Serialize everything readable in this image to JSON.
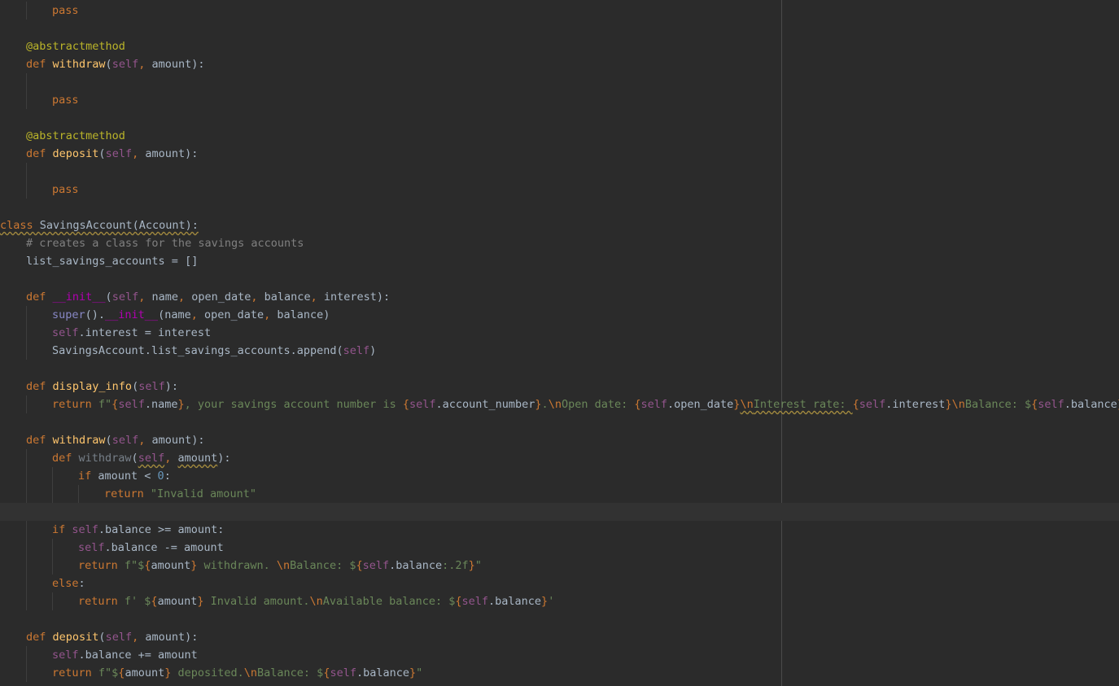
{
  "editor": {
    "theme": {
      "background": "#2b2b2b",
      "foreground": "#a9b7c6",
      "current_line": "#323232",
      "margin_line": "#4a4a4a"
    },
    "lines": [
      {
        "indent": 2,
        "tokens": [
          [
            "pass",
            "kw"
          ]
        ]
      },
      {
        "indent": 0,
        "tokens": []
      },
      {
        "indent": 1,
        "tokens": [
          [
            "@abstractmethod",
            "deco"
          ]
        ]
      },
      {
        "indent": 1,
        "tokens": [
          [
            "def ",
            "kw"
          ],
          [
            "withdraw",
            "fn"
          ],
          [
            "(",
            ""
          ],
          [
            "self",
            "self"
          ],
          [
            ", ",
            "kw"
          ],
          [
            "amount):",
            ""
          ]
        ]
      },
      {
        "indent": 2,
        "tokens": []
      },
      {
        "indent": 2,
        "tokens": [
          [
            "pass",
            "kw"
          ]
        ]
      },
      {
        "indent": 0,
        "tokens": []
      },
      {
        "indent": 1,
        "tokens": [
          [
            "@abstractmethod",
            "deco"
          ]
        ]
      },
      {
        "indent": 1,
        "tokens": [
          [
            "def ",
            "kw"
          ],
          [
            "deposit",
            "fn"
          ],
          [
            "(",
            ""
          ],
          [
            "self",
            "self"
          ],
          [
            ", ",
            "kw"
          ],
          [
            "amount):",
            ""
          ]
        ]
      },
      {
        "indent": 2,
        "tokens": []
      },
      {
        "indent": 2,
        "tokens": [
          [
            "pass",
            "kw"
          ]
        ]
      },
      {
        "indent": 0,
        "tokens": []
      },
      {
        "indent": 0,
        "tokens": [
          [
            "class ",
            "kw wavy"
          ],
          [
            "SavingsAccount(Account):",
            "wavy"
          ]
        ]
      },
      {
        "indent": 1,
        "tokens": [
          [
            "# creates a class for the savings accounts",
            "cmt"
          ]
        ]
      },
      {
        "indent": 1,
        "tokens": [
          [
            "list_savings_accounts = []",
            ""
          ]
        ]
      },
      {
        "indent": 0,
        "tokens": []
      },
      {
        "indent": 1,
        "tokens": [
          [
            "def ",
            "kw"
          ],
          [
            "__init__",
            "dunder"
          ],
          [
            "(",
            ""
          ],
          [
            "self",
            "self"
          ],
          [
            ", ",
            "kw"
          ],
          [
            "name",
            ""
          ],
          [
            ", ",
            "kw"
          ],
          [
            "open_date",
            ""
          ],
          [
            ", ",
            "kw"
          ],
          [
            "balance",
            ""
          ],
          [
            ", ",
            "kw"
          ],
          [
            "interest):",
            ""
          ]
        ]
      },
      {
        "indent": 2,
        "tokens": [
          [
            "super",
            "bi"
          ],
          [
            "().",
            ""
          ],
          [
            "__init__",
            "dunder"
          ],
          [
            "(name",
            ""
          ],
          [
            ", ",
            "kw"
          ],
          [
            "open_date",
            ""
          ],
          [
            ", ",
            "kw"
          ],
          [
            "balance)",
            ""
          ]
        ]
      },
      {
        "indent": 2,
        "tokens": [
          [
            "self",
            "self"
          ],
          [
            ".interest = interest",
            ""
          ]
        ]
      },
      {
        "indent": 2,
        "tokens": [
          [
            "SavingsAccount.list_savings_accounts.append(",
            ""
          ],
          [
            "self",
            "self"
          ],
          [
            ")",
            ""
          ]
        ]
      },
      {
        "indent": 0,
        "tokens": []
      },
      {
        "indent": 1,
        "tokens": [
          [
            "def ",
            "kw"
          ],
          [
            "display_info",
            "fn"
          ],
          [
            "(",
            ""
          ],
          [
            "self",
            "self"
          ],
          [
            "):",
            ""
          ]
        ]
      },
      {
        "indent": 2,
        "tokens": [
          [
            "return ",
            "kw"
          ],
          [
            "f\"",
            "str"
          ],
          [
            "{",
            "br"
          ],
          [
            "self",
            "self"
          ],
          [
            ".name",
            ""
          ],
          [
            "}",
            "br"
          ],
          [
            ", your savings account number is ",
            "str"
          ],
          [
            "{",
            "br"
          ],
          [
            "self",
            "self"
          ],
          [
            ".account_number",
            ""
          ],
          [
            "}",
            "br"
          ],
          [
            ".",
            "str"
          ],
          [
            "\\n",
            "esc"
          ],
          [
            "Open date: ",
            "str"
          ],
          [
            "{",
            "br"
          ],
          [
            "self",
            "self"
          ],
          [
            ".open_date",
            ""
          ],
          [
            "}",
            "br"
          ],
          [
            "\\n",
            "esc wavy"
          ],
          [
            "Interest rate: ",
            "str wavy"
          ],
          [
            "{",
            "br"
          ],
          [
            "self",
            "self"
          ],
          [
            ".interest",
            ""
          ],
          [
            "}",
            "br"
          ],
          [
            "\\n",
            "esc"
          ],
          [
            "Balance: $",
            "str"
          ],
          [
            "{",
            "br"
          ],
          [
            "self",
            "self"
          ],
          [
            ".balance",
            ""
          ],
          [
            "}",
            "br"
          ],
          [
            "\"",
            "str"
          ]
        ]
      },
      {
        "indent": 0,
        "tokens": []
      },
      {
        "indent": 1,
        "tokens": [
          [
            "def ",
            "kw"
          ],
          [
            "withdraw",
            "fn"
          ],
          [
            "(",
            ""
          ],
          [
            "self",
            "self"
          ],
          [
            ", ",
            "kw"
          ],
          [
            "amount):",
            ""
          ]
        ]
      },
      {
        "indent": 2,
        "tokens": [
          [
            "def ",
            "kw"
          ],
          [
            "withdraw",
            "fnd"
          ],
          [
            "(",
            ""
          ],
          [
            "self",
            "self wavy"
          ],
          [
            ", ",
            "kw"
          ],
          [
            "amount",
            "wavy"
          ],
          [
            "):",
            ""
          ]
        ]
      },
      {
        "indent": 3,
        "tokens": [
          [
            "if ",
            "kw"
          ],
          [
            "amount < ",
            ""
          ],
          [
            "0",
            "num"
          ],
          [
            ":",
            ""
          ]
        ]
      },
      {
        "indent": 4,
        "tokens": [
          [
            "return ",
            "kw"
          ],
          [
            "\"Invalid amount\"",
            "str"
          ]
        ]
      },
      {
        "indent": 0,
        "tokens": [],
        "current": true
      },
      {
        "indent": 2,
        "tokens": [
          [
            "if ",
            "kw"
          ],
          [
            "self",
            "self"
          ],
          [
            ".balance >= amount:",
            ""
          ]
        ]
      },
      {
        "indent": 3,
        "tokens": [
          [
            "self",
            "self"
          ],
          [
            ".balance -= amount",
            ""
          ]
        ]
      },
      {
        "indent": 3,
        "tokens": [
          [
            "return ",
            "kw"
          ],
          [
            "f\"$",
            "str"
          ],
          [
            "{",
            "br"
          ],
          [
            "amount",
            ""
          ],
          [
            "}",
            "br"
          ],
          [
            " withdrawn. ",
            "str"
          ],
          [
            "\\n",
            "esc"
          ],
          [
            "Balance: $",
            "str"
          ],
          [
            "{",
            "br"
          ],
          [
            "self",
            "self"
          ],
          [
            ".balance",
            ""
          ],
          [
            ":.2f",
            "str"
          ],
          [
            "}",
            "br"
          ],
          [
            "\"",
            "str"
          ]
        ]
      },
      {
        "indent": 2,
        "tokens": [
          [
            "else",
            "kw"
          ],
          [
            ":",
            ""
          ]
        ]
      },
      {
        "indent": 3,
        "tokens": [
          [
            "return ",
            "kw"
          ],
          [
            "f' $",
            "str"
          ],
          [
            "{",
            "br"
          ],
          [
            "amount",
            ""
          ],
          [
            "}",
            "br"
          ],
          [
            " Invalid amount.",
            "str"
          ],
          [
            "\\n",
            "esc"
          ],
          [
            "Available balance: $",
            "str"
          ],
          [
            "{",
            "br"
          ],
          [
            "self",
            "self"
          ],
          [
            ".balance",
            ""
          ],
          [
            "}",
            "br"
          ],
          [
            "'",
            "str"
          ]
        ]
      },
      {
        "indent": 0,
        "tokens": []
      },
      {
        "indent": 1,
        "tokens": [
          [
            "def ",
            "kw"
          ],
          [
            "deposit",
            "fn"
          ],
          [
            "(",
            ""
          ],
          [
            "self",
            "self"
          ],
          [
            ", ",
            "kw"
          ],
          [
            "amount):",
            ""
          ]
        ]
      },
      {
        "indent": 2,
        "tokens": [
          [
            "self",
            "self"
          ],
          [
            ".balance += amount",
            ""
          ]
        ]
      },
      {
        "indent": 2,
        "tokens": [
          [
            "return ",
            "kw"
          ],
          [
            "f\"$",
            "str"
          ],
          [
            "{",
            "br"
          ],
          [
            "amount",
            ""
          ],
          [
            "}",
            "br"
          ],
          [
            " deposited.",
            "str"
          ],
          [
            "\\n",
            "esc"
          ],
          [
            "Balance: $",
            "str"
          ],
          [
            "{",
            "br"
          ],
          [
            "self",
            "self"
          ],
          [
            ".balance",
            ""
          ],
          [
            "}",
            "br"
          ],
          [
            "\"",
            "str"
          ]
        ]
      }
    ]
  }
}
